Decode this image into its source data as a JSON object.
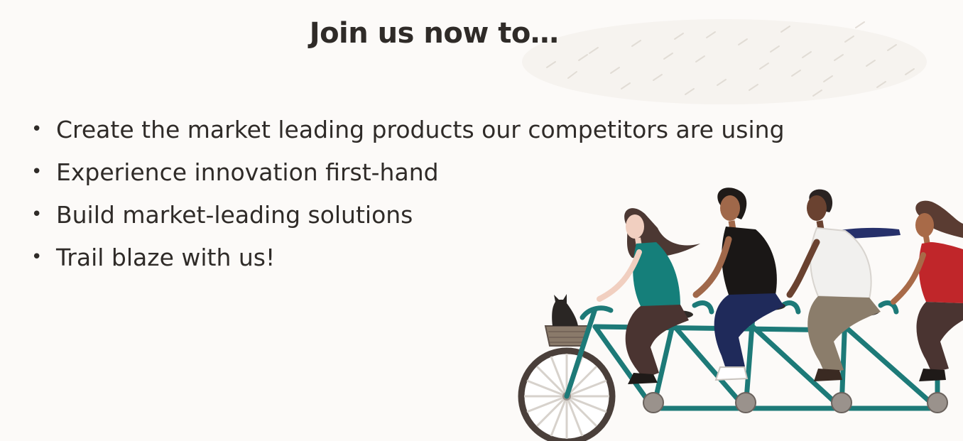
{
  "slide": {
    "title": "Join us now to…",
    "bullets": [
      "Create the market leading products our competitors are using",
      "Experience innovation first-hand",
      "Build market-leading solutions",
      "Trail blaze with us!"
    ],
    "bullet_glyph": "•"
  },
  "colors": {
    "background": "#fcfaf8",
    "text": "#2f2b28",
    "bike_frame": "#1d7a78",
    "texture": "#e6e1da"
  },
  "icons": {
    "illustration": "tandem-bicycle-illustration",
    "texture": "leaf-texture"
  }
}
